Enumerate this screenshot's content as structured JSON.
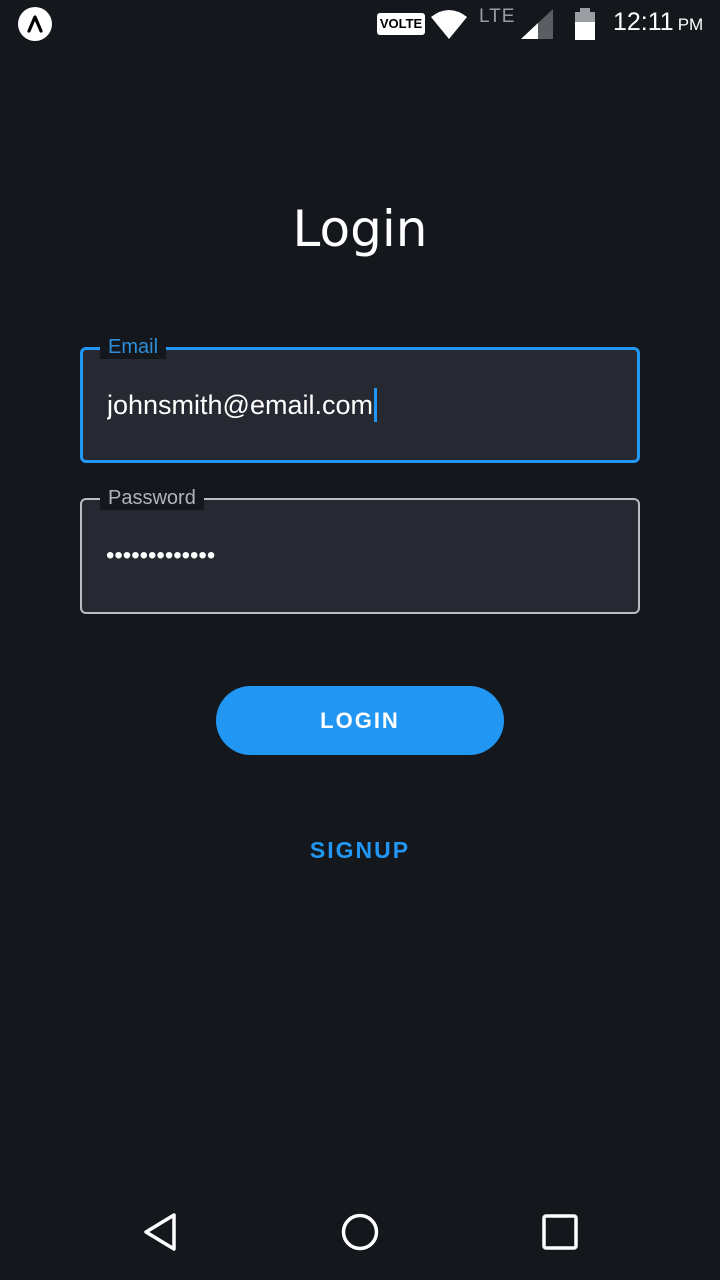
{
  "status_bar": {
    "volte": "VOLTE",
    "network_type": "LTE",
    "time": "12:11",
    "ampm": "PM",
    "icons": [
      "app-launcher-icon",
      "wifi-icon",
      "signal-icon",
      "battery-icon"
    ]
  },
  "login_form": {
    "title": "Login",
    "email": {
      "label": "Email",
      "value": "johnsmith@email.com"
    },
    "password": {
      "label": "Password",
      "value": "•••••••••••••"
    },
    "login_label": "LOGIN",
    "signup_label": "SIGNUP"
  },
  "nav_bar": {
    "icons": [
      "back-icon",
      "home-icon",
      "recents-icon"
    ]
  },
  "colors": {
    "background": "#14171c",
    "field_background": "#262932",
    "accent": "#2196f3",
    "muted_border": "#b9bdc4"
  }
}
